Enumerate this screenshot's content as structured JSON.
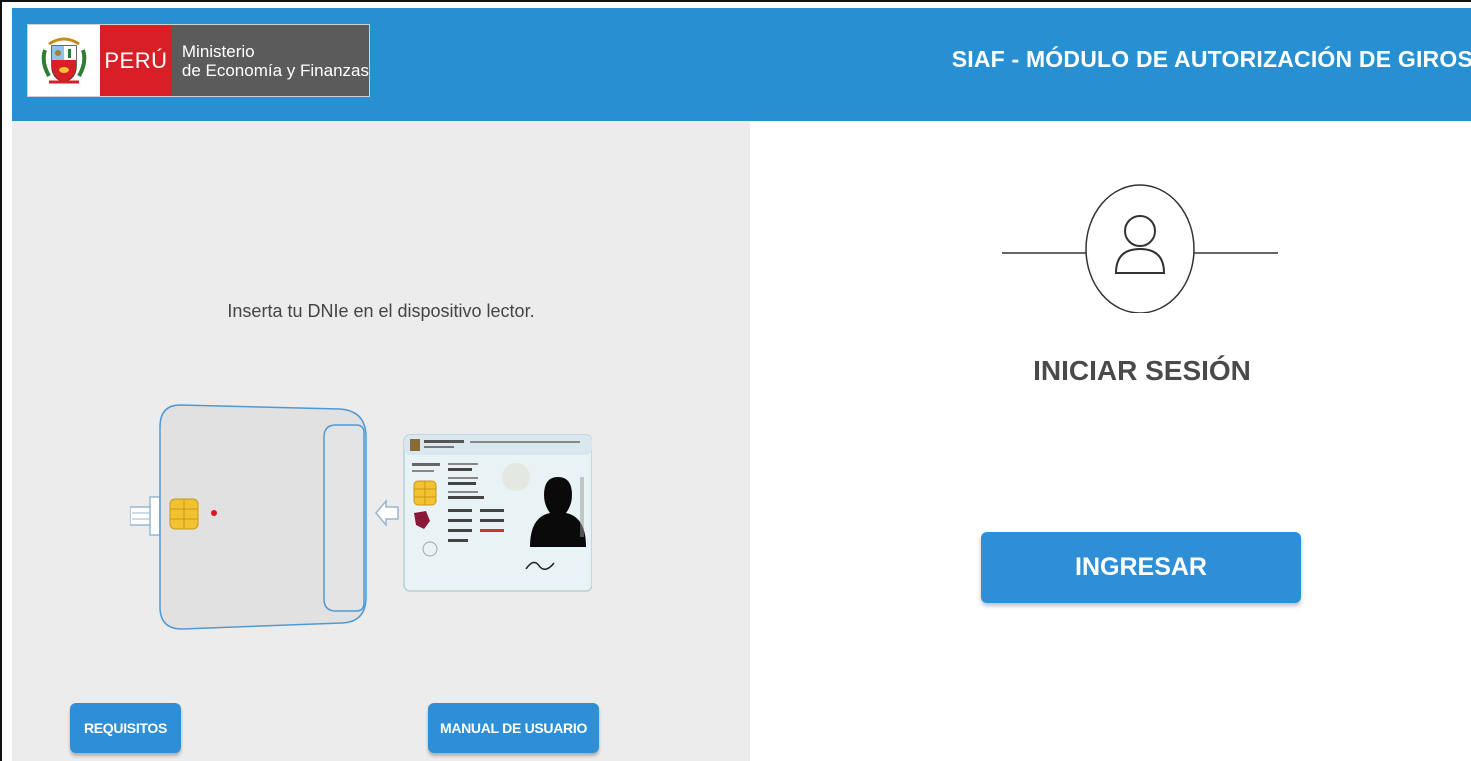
{
  "header": {
    "logo": {
      "country": "PERÚ",
      "ministry_line1": "Ministerio",
      "ministry_line2": "de Economía y Finanzas"
    },
    "title": "SIAF - MÓDULO DE AUTORIZACIÓN DE GIROS"
  },
  "left": {
    "instruction": "Inserta tu DNIe en el dispositivo lector.",
    "buttons": {
      "requisitos": "REQUISITOS",
      "manual": "MANUAL DE USUARIO"
    },
    "illustration": {
      "icons": [
        "card-reader-icon",
        "dni-card-icon",
        "arrow-left-icon",
        "chip-icon",
        "led-indicator-icon"
      ]
    }
  },
  "right": {
    "user_icon": "user-icon",
    "login_title": "INICIAR SESIÓN",
    "ingresar_label": "INGRESAR"
  },
  "colors": {
    "header_bg": "#2690d2",
    "button_bg": "#2f8fd6",
    "peru_red": "#d91f26",
    "ministry_gray": "#5b5b5b",
    "left_panel_bg": "#ececec"
  }
}
